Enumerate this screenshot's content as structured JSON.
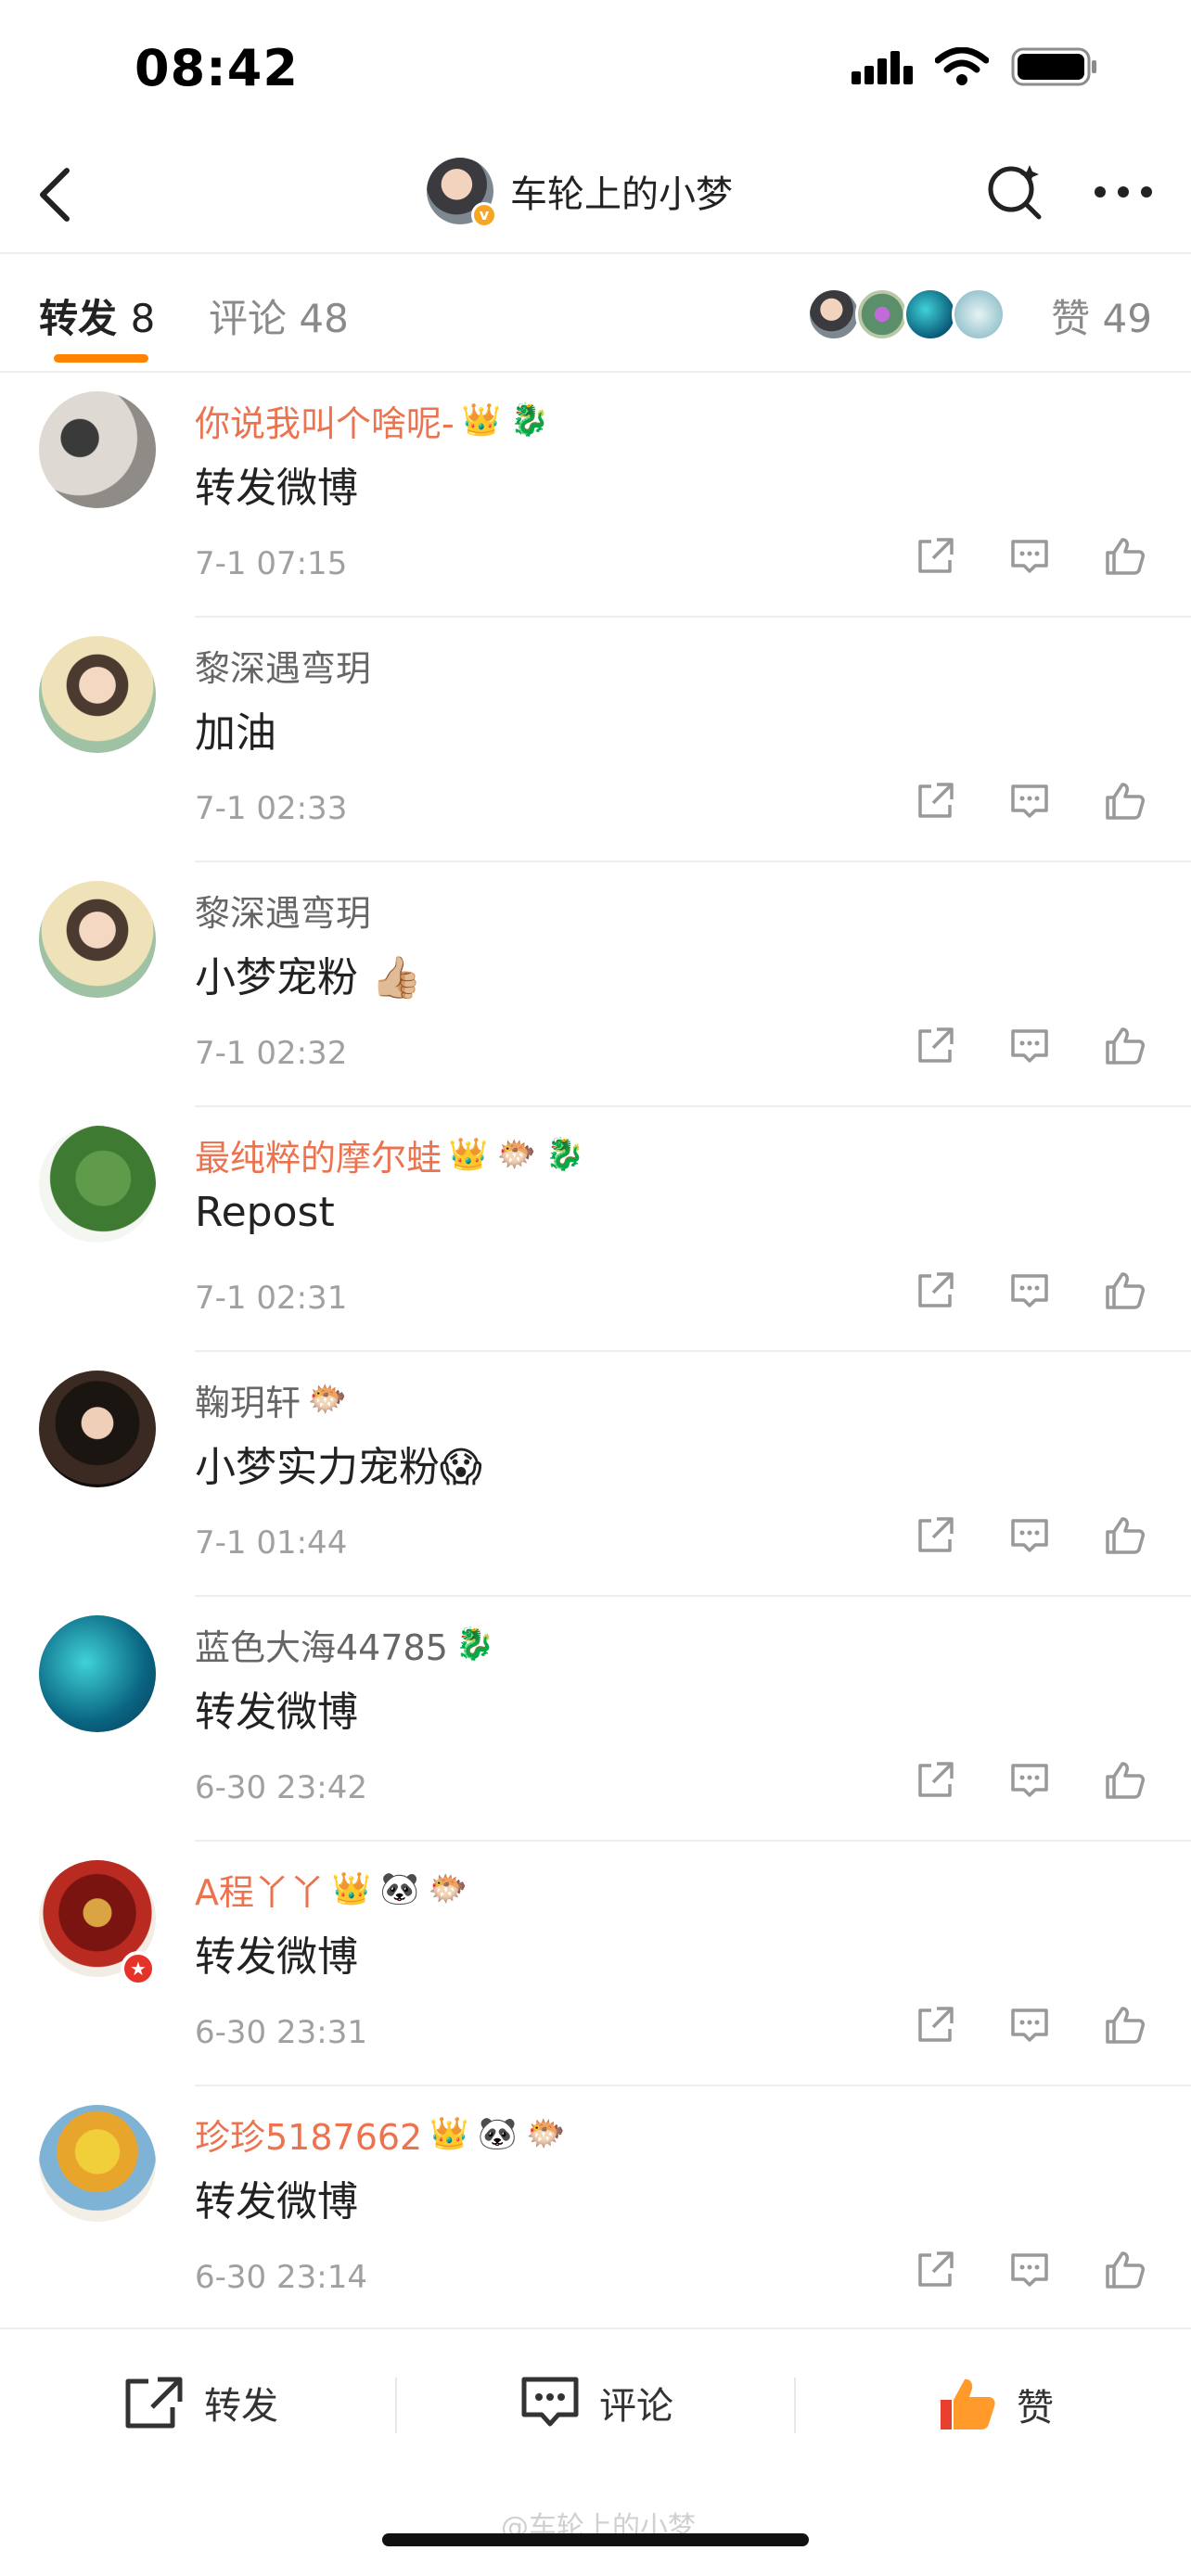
{
  "status_bar": {
    "time": "08:42",
    "icons": [
      "cellular-icon",
      "wifi-icon",
      "battery-icon"
    ]
  },
  "header": {
    "title": "车轮上的小梦",
    "verified_badge": "v"
  },
  "tabs": {
    "repost_label": "转发",
    "repost_count": "8",
    "comment_label": "评论",
    "comment_count": "48",
    "like_label": "赞",
    "like_count": "49",
    "accent_color": "#ff8200"
  },
  "reposts": [
    {
      "username": "你说我叫个啥呢-",
      "name_color": "orange",
      "badges": [
        "👑",
        "🐉"
      ],
      "content": "转发微博",
      "time": "7-1 07:15"
    },
    {
      "username": "黎深遇弯玥",
      "name_color": "gray",
      "badges": [],
      "content": "加油",
      "time": "7-1 02:33"
    },
    {
      "username": "黎深遇弯玥",
      "name_color": "gray",
      "badges": [],
      "content": "小梦宠粉 👍🏼",
      "time": "7-1 02:32"
    },
    {
      "username": "最纯粹的摩尔蛙",
      "name_color": "orange",
      "badges": [
        "👑",
        "🐡",
        "🐉"
      ],
      "content": "Repost",
      "time": "7-1 02:31"
    },
    {
      "username": "鞠玥轩",
      "name_color": "gray",
      "badges": [
        "🐡"
      ],
      "content": "小梦实力宠粉😱",
      "time": "7-1 01:44"
    },
    {
      "username": "蓝色大海44785",
      "name_color": "gray",
      "badges": [
        "🐉"
      ],
      "content": "转发微博",
      "time": "6-30 23:42"
    },
    {
      "username": "A程丫丫",
      "name_color": "orange",
      "badges": [
        "👑",
        "🐼",
        "🐡"
      ],
      "content": "转发微博",
      "time": "6-30 23:31"
    },
    {
      "username": "珍珍5187662",
      "name_color": "orange",
      "badges": [
        "👑",
        "🐼",
        "🐡"
      ],
      "content": "转发微博",
      "time": "6-30 23:14"
    }
  ],
  "bottom_bar": {
    "repost_label": "转发",
    "comment_label": "评论",
    "like_label": "赞",
    "like_color": "#ff8200"
  }
}
